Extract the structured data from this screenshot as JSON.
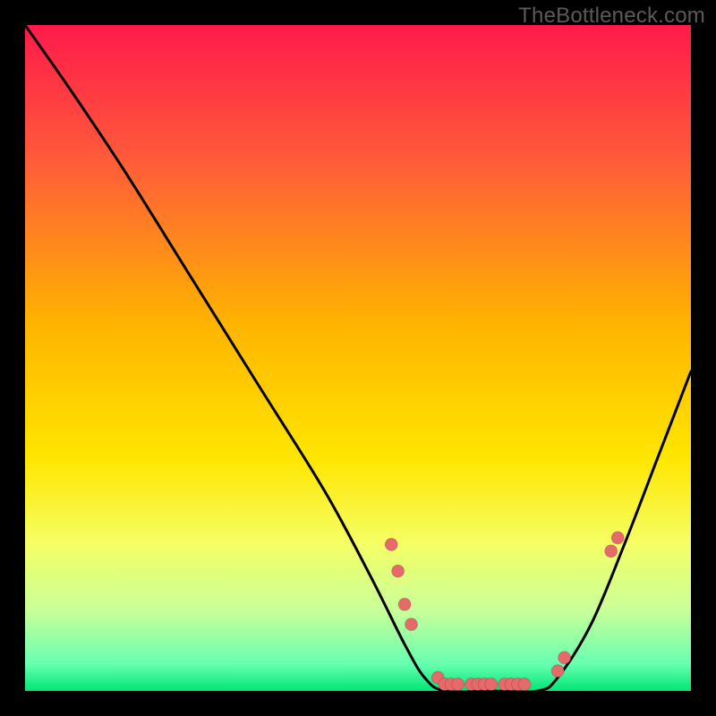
{
  "watermark": "TheBottleneck.com",
  "chart_data": {
    "type": "line",
    "title": "",
    "xlabel": "",
    "ylabel": "",
    "xlim": [
      0,
      100
    ],
    "ylim": [
      0,
      100
    ],
    "gradient_stops": [
      {
        "offset": 0,
        "color": "#ff1a4b"
      },
      {
        "offset": 0.2,
        "color": "#ff5a3a"
      },
      {
        "offset": 0.45,
        "color": "#ffb400"
      },
      {
        "offset": 0.65,
        "color": "#ffe600"
      },
      {
        "offset": 0.78,
        "color": "#f5ff66"
      },
      {
        "offset": 0.88,
        "color": "#c8ff99"
      },
      {
        "offset": 0.96,
        "color": "#66ffb0"
      },
      {
        "offset": 1.0,
        "color": "#00e676"
      }
    ],
    "curve": [
      {
        "x": 0,
        "y": 100
      },
      {
        "x": 7,
        "y": 90
      },
      {
        "x": 15,
        "y": 78
      },
      {
        "x": 25,
        "y": 62
      },
      {
        "x": 35,
        "y": 46
      },
      {
        "x": 45,
        "y": 30
      },
      {
        "x": 52,
        "y": 17
      },
      {
        "x": 57,
        "y": 7
      },
      {
        "x": 60,
        "y": 2
      },
      {
        "x": 63,
        "y": 0
      },
      {
        "x": 70,
        "y": 0
      },
      {
        "x": 77,
        "y": 0
      },
      {
        "x": 80,
        "y": 2
      },
      {
        "x": 85,
        "y": 10
      },
      {
        "x": 90,
        "y": 22
      },
      {
        "x": 95,
        "y": 35
      },
      {
        "x": 100,
        "y": 48
      }
    ],
    "markers": [
      {
        "x": 55,
        "y": 22
      },
      {
        "x": 56,
        "y": 18
      },
      {
        "x": 57,
        "y": 13
      },
      {
        "x": 58,
        "y": 10
      },
      {
        "x": 62,
        "y": 2
      },
      {
        "x": 63,
        "y": 1
      },
      {
        "x": 64,
        "y": 1
      },
      {
        "x": 65,
        "y": 1
      },
      {
        "x": 67,
        "y": 1
      },
      {
        "x": 68,
        "y": 1
      },
      {
        "x": 69,
        "y": 1
      },
      {
        "x": 70,
        "y": 1
      },
      {
        "x": 72,
        "y": 1
      },
      {
        "x": 73,
        "y": 1
      },
      {
        "x": 74,
        "y": 1
      },
      {
        "x": 75,
        "y": 1
      },
      {
        "x": 80,
        "y": 3
      },
      {
        "x": 81,
        "y": 5
      },
      {
        "x": 88,
        "y": 21
      },
      {
        "x": 89,
        "y": 23
      }
    ],
    "marker_color": "#e66a6a",
    "marker_radius": 7
  }
}
